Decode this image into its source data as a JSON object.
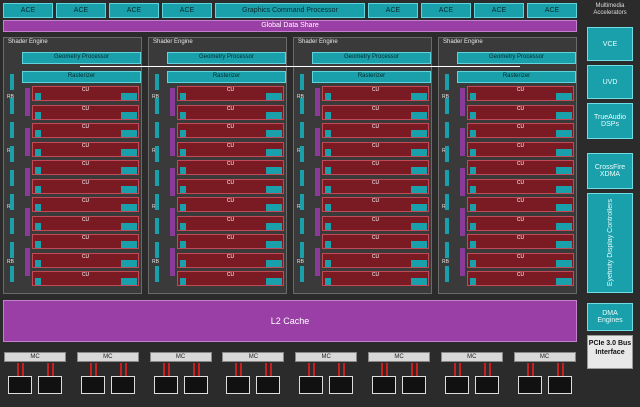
{
  "top_bar": {
    "ace_left": [
      "ACE",
      "ACE",
      "ACE",
      "ACE"
    ],
    "gcp": "Graphics Command Processor",
    "ace_right": [
      "ACE",
      "ACE",
      "ACE",
      "ACE"
    ]
  },
  "gds": "Global Data Share",
  "shader_engines": [
    {
      "title": "Shader Engine",
      "geometry": "Geometry Processor",
      "rasterizer": "Rasterizer",
      "rb": "RB",
      "cu": "CU"
    },
    {
      "title": "Shader Engine",
      "geometry": "Geometry Processor",
      "rasterizer": "Rasterizer",
      "rb": "RB",
      "cu": "CU"
    },
    {
      "title": "Shader Engine",
      "geometry": "Geometry Processor",
      "rasterizer": "Rasterizer",
      "rb": "RB",
      "cu": "CU"
    },
    {
      "title": "Shader Engine",
      "geometry": "Geometry Processor",
      "rasterizer": "Rasterizer",
      "rb": "RB",
      "cu": "CU"
    }
  ],
  "l2": "L2 Cache",
  "mc_label": "MC",
  "right": {
    "multimedia_title": "Multimedia Accelerators",
    "vce": "VCE",
    "uvd": "UVD",
    "trueaudio": "TrueAudio DSPs",
    "crossfire": "CrossFire XDMA",
    "eyefinity": "Eyefinity Display Controllers",
    "dma": "DMA Engines",
    "pcie": "PCIe 3.0 Bus Interface"
  },
  "colors": {
    "teal": "#1aa0aa",
    "purple": "#9a3fa6",
    "cu_red": "#7a1a22",
    "background": "#2b2b2b"
  }
}
